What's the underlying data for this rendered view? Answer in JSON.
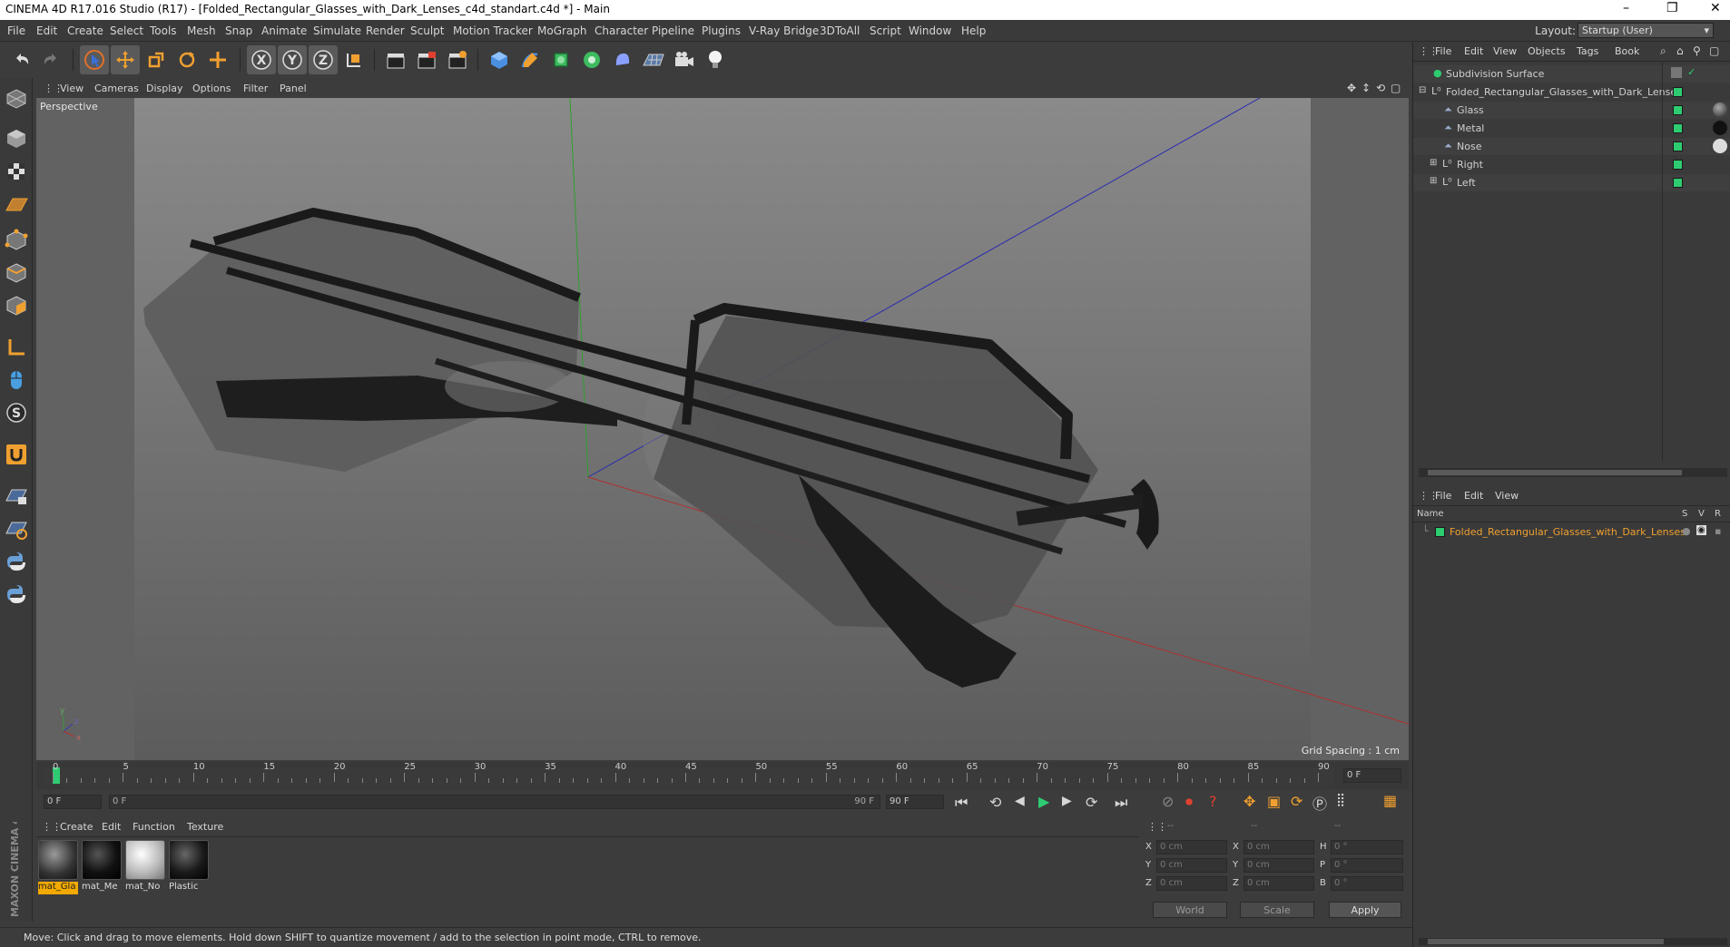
{
  "window": {
    "title": "CINEMA 4D R17.016 Studio (R17) - [Folded_Rectangular_Glasses_with_Dark_Lenses_c4d_standart.c4d *] - Main",
    "minimize": "–",
    "maximize": "❐",
    "close": "✕"
  },
  "menu": [
    "File",
    "Edit",
    "Create",
    "Select",
    "Tools",
    "Mesh",
    "Snap",
    "Animate",
    "Simulate",
    "Render",
    "Sculpt",
    "Motion Tracker",
    "MoGraph",
    "Character",
    "Pipeline",
    "Plugins",
    "V-Ray Bridge",
    "3DToAll",
    "Script",
    "Window",
    "Help"
  ],
  "layout": {
    "label": "Layout:",
    "value": "Startup (User)"
  },
  "viewport": {
    "menu": [
      "View",
      "Cameras",
      "Display",
      "Options",
      "Filter",
      "Panel"
    ],
    "label": "Perspective",
    "grid_spacing": "Grid Spacing : 1 cm"
  },
  "timeline": {
    "ticks": [
      "0",
      "5",
      "10",
      "15",
      "20",
      "25",
      "30",
      "35",
      "40",
      "45",
      "50",
      "55",
      "60",
      "65",
      "70",
      "75",
      "80",
      "85",
      "90"
    ],
    "current_frame": "0 F",
    "start": "0 F",
    "range_start": "0 F",
    "range_end": "90 F",
    "end": "90 F"
  },
  "materials": {
    "menu": [
      "Create",
      "Edit",
      "Function",
      "Texture"
    ],
    "items": [
      {
        "name": "mat_Gla",
        "selected": true
      },
      {
        "name": "mat_Me",
        "selected": false
      },
      {
        "name": "mat_No",
        "selected": false
      },
      {
        "name": "Plastic",
        "selected": false
      }
    ]
  },
  "coords": {
    "header": [
      "--",
      "--",
      "--"
    ],
    "x": "0 cm",
    "y": "0 cm",
    "z": "0 cm",
    "sx": "0 cm",
    "sy": "0 cm",
    "sz": "0 cm",
    "h": "0 °",
    "p": "0 °",
    "b": "0 °",
    "labels": {
      "x": "X",
      "y": "Y",
      "z": "Z",
      "h": "H",
      "p": "P",
      "b": "B"
    },
    "world": "World",
    "scale": "Scale",
    "apply": "Apply"
  },
  "status": "Move: Click and drag to move elements. Hold down SHIFT to quantize movement / add to the selection in point mode, CTRL to remove.",
  "objects": {
    "menu": [
      "File",
      "Edit",
      "View",
      "Objects",
      "Tags",
      "Book"
    ],
    "items": [
      {
        "name": "Subdivision Surface",
        "indent": 0
      },
      {
        "name": "Folded_Rectangular_Glasses_with_Dark_Lenses",
        "indent": 0
      },
      {
        "name": "Glass",
        "indent": 1
      },
      {
        "name": "Metal",
        "indent": 1
      },
      {
        "name": "Nose",
        "indent": 1
      },
      {
        "name": "Right",
        "indent": 1
      },
      {
        "name": "Left",
        "indent": 1
      }
    ]
  },
  "layers": {
    "menu": [
      "File",
      "Edit",
      "View"
    ],
    "col_name": "Name",
    "col_s": "S",
    "col_v": "V",
    "col_r": "R",
    "item": "Folded_Rectangular_Glasses_with_Dark_Lenses"
  },
  "brand": "MAXON CINEMA 4D",
  "colors": {
    "accent_green": "#2ecc71",
    "orange": "#f0a030",
    "selection": "#f2a900"
  }
}
